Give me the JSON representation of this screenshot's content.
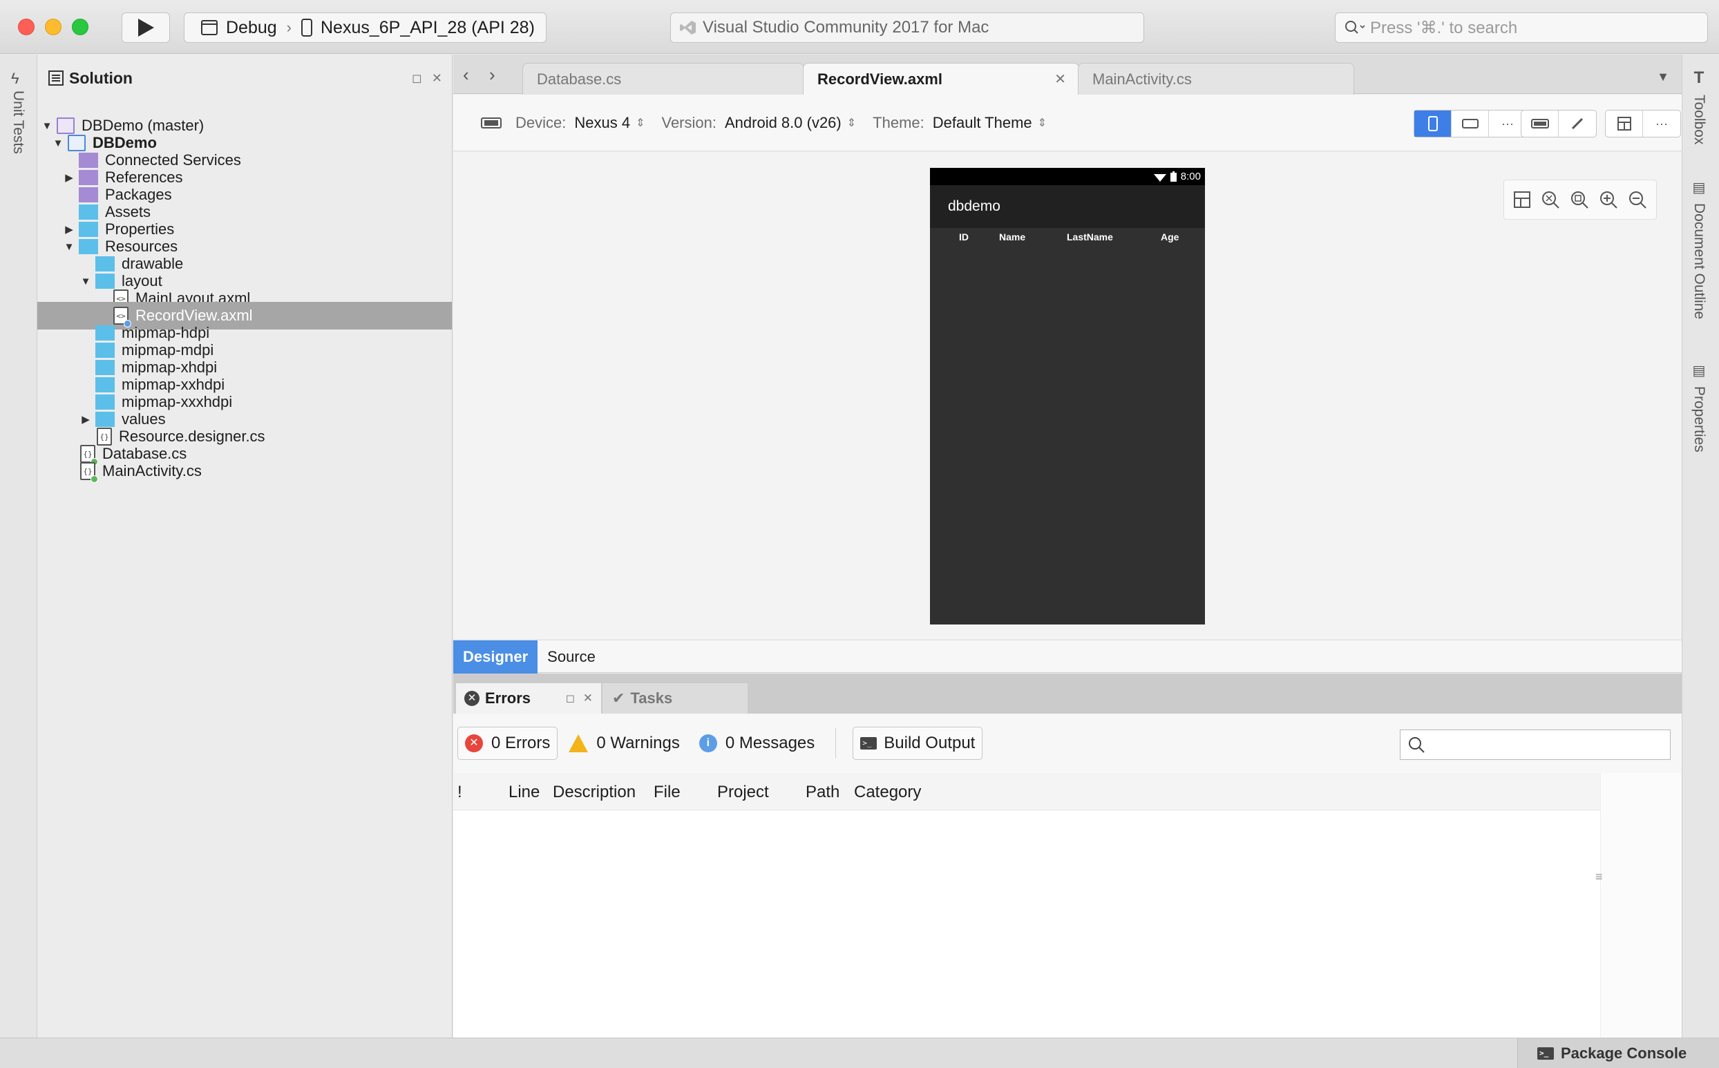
{
  "titlebar": {
    "configuration": "Debug",
    "device": "Nexus_6P_API_28 (API 28)",
    "app_title": "Visual Studio Community 2017 for Mac",
    "search_placeholder": "Press '⌘.' to search"
  },
  "left_pad": {
    "unit_tests_label": "Unit Tests"
  },
  "solution": {
    "title": "Solution",
    "items": [
      {
        "label": "DBDemo (master)",
        "bold": false
      },
      {
        "label": "DBDemo",
        "bold": true
      },
      {
        "label": "Connected Services"
      },
      {
        "label": "References"
      },
      {
        "label": "Packages"
      },
      {
        "label": "Assets"
      },
      {
        "label": "Properties"
      },
      {
        "label": "Resources"
      },
      {
        "label": "drawable"
      },
      {
        "label": "layout"
      },
      {
        "label": "MainLayout.axml"
      },
      {
        "label": "RecordView.axml"
      },
      {
        "label": "mipmap-hdpi"
      },
      {
        "label": "mipmap-mdpi"
      },
      {
        "label": "mipmap-xhdpi"
      },
      {
        "label": "mipmap-xxhdpi"
      },
      {
        "label": "mipmap-xxxhdpi"
      },
      {
        "label": "values"
      },
      {
        "label": "Resource.designer.cs"
      },
      {
        "label": "Database.cs"
      },
      {
        "label": "MainActivity.cs"
      }
    ]
  },
  "tabs": [
    {
      "label": "Database.cs"
    },
    {
      "label": "RecordView.axml"
    },
    {
      "label": "MainActivity.cs"
    }
  ],
  "designer_toolbar": {
    "device_label": "Device:",
    "device_value": "Nexus 4",
    "version_label": "Version:",
    "version_value": "Android 8.0 (v26)",
    "theme_label": "Theme:",
    "theme_value": "Default Theme"
  },
  "phone": {
    "time": "8:00",
    "app_name": "dbdemo",
    "columns": [
      "ID",
      "Name",
      "LastName",
      "Age"
    ]
  },
  "view_tabs": {
    "designer": "Designer",
    "source": "Source"
  },
  "errors_pad": {
    "errors_tab": "Errors",
    "tasks_tab": "Tasks",
    "errors_count": "0 Errors",
    "warnings_count": "0 Warnings",
    "messages_count": "0 Messages",
    "build_output": "Build Output",
    "columns": [
      "!",
      "Line",
      "Description",
      "File",
      "Project",
      "Path",
      "Category"
    ]
  },
  "right_pad": {
    "toolbox": "Toolbox",
    "document_outline": "Document Outline",
    "properties": "Properties"
  },
  "statusbar": {
    "package_console": "Package Console"
  },
  "colors": {
    "accent": "#3d7fe6",
    "folder": "#5bbfe9",
    "selection": "#a6a6a6"
  }
}
